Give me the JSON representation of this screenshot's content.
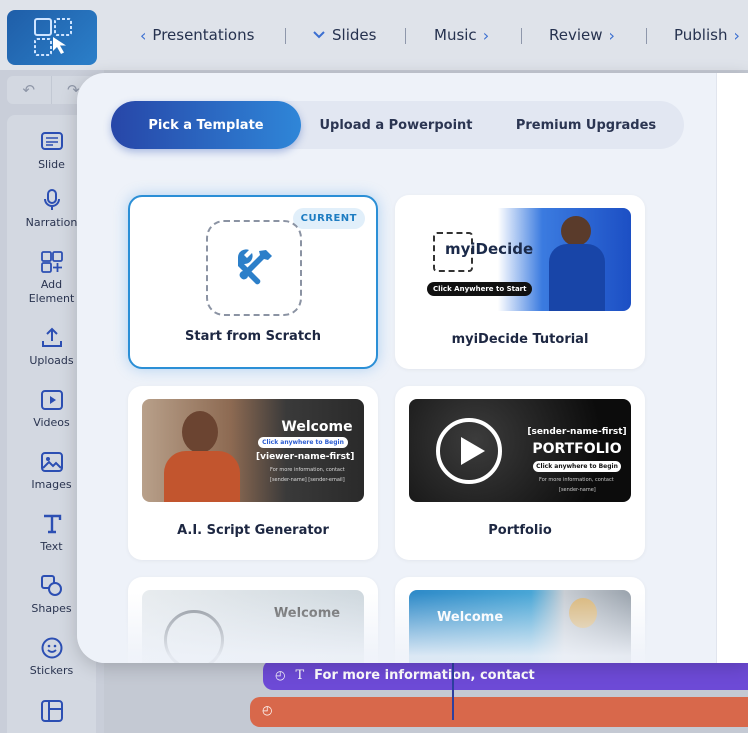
{
  "topnav": {
    "items": [
      {
        "label": "Presentations",
        "icon": "chevron-left-icon"
      },
      {
        "label": "Slides",
        "icon": "chevron-down-icon"
      },
      {
        "label": "Music",
        "icon": "chevron-right-icon"
      },
      {
        "label": "Review",
        "icon": "chevron-right-icon"
      },
      {
        "label": "Publish",
        "icon": "chevron-right-icon"
      }
    ]
  },
  "toolbar": {
    "undo_icon": "undo-icon",
    "redo_icon": "redo-icon"
  },
  "sidebar": {
    "items": [
      {
        "label": "Slide",
        "icon": "slide-icon"
      },
      {
        "label": "Narration",
        "icon": "microphone-icon"
      },
      {
        "label": "Add\nElement",
        "icon": "add-element-icon"
      },
      {
        "label": "Uploads",
        "icon": "upload-icon"
      },
      {
        "label": "Videos",
        "icon": "video-icon"
      },
      {
        "label": "Images",
        "icon": "image-icon"
      },
      {
        "label": "Text",
        "icon": "text-icon"
      },
      {
        "label": "Shapes",
        "icon": "shapes-icon"
      },
      {
        "label": "Stickers",
        "icon": "sticker-icon"
      },
      {
        "label": "",
        "icon": "layout-icon"
      }
    ]
  },
  "timeline": {
    "track1_text": "For more information, contact"
  },
  "modal": {
    "tabs": [
      {
        "label": "Pick a Template",
        "active": true
      },
      {
        "label": "Upload a Powerpoint",
        "active": false
      },
      {
        "label": "Premium Upgrades",
        "active": false
      }
    ],
    "templates": [
      {
        "label": "Start from Scratch",
        "badge": "CURRENT",
        "current": true
      },
      {
        "label": "myiDecide Tutorial",
        "thumb_text": [
          "myiDecide",
          "Click Anywhere to Start"
        ]
      },
      {
        "label": "A.I. Script Generator",
        "thumb_text": [
          "Welcome",
          "Click anywhere to Begin",
          "[viewer-name-first]",
          "For more information, contact",
          "[sender-name]  [sender-email]"
        ]
      },
      {
        "label": "Portfolio",
        "thumb_text": [
          "[sender-name-first]",
          "PORTFOLIO",
          "Click anywhere to Begin",
          "For more information, contact",
          "[sender-name]"
        ]
      },
      {
        "label": "",
        "thumb_text": [
          "Welcome"
        ]
      },
      {
        "label": "",
        "thumb_text": [
          "Welcome"
        ]
      }
    ]
  },
  "colors": {
    "accent": "#2f86d8",
    "active_tab_start": "#2746a8",
    "track_purple": "#6d4ad6",
    "track_orange": "#d8684b"
  }
}
